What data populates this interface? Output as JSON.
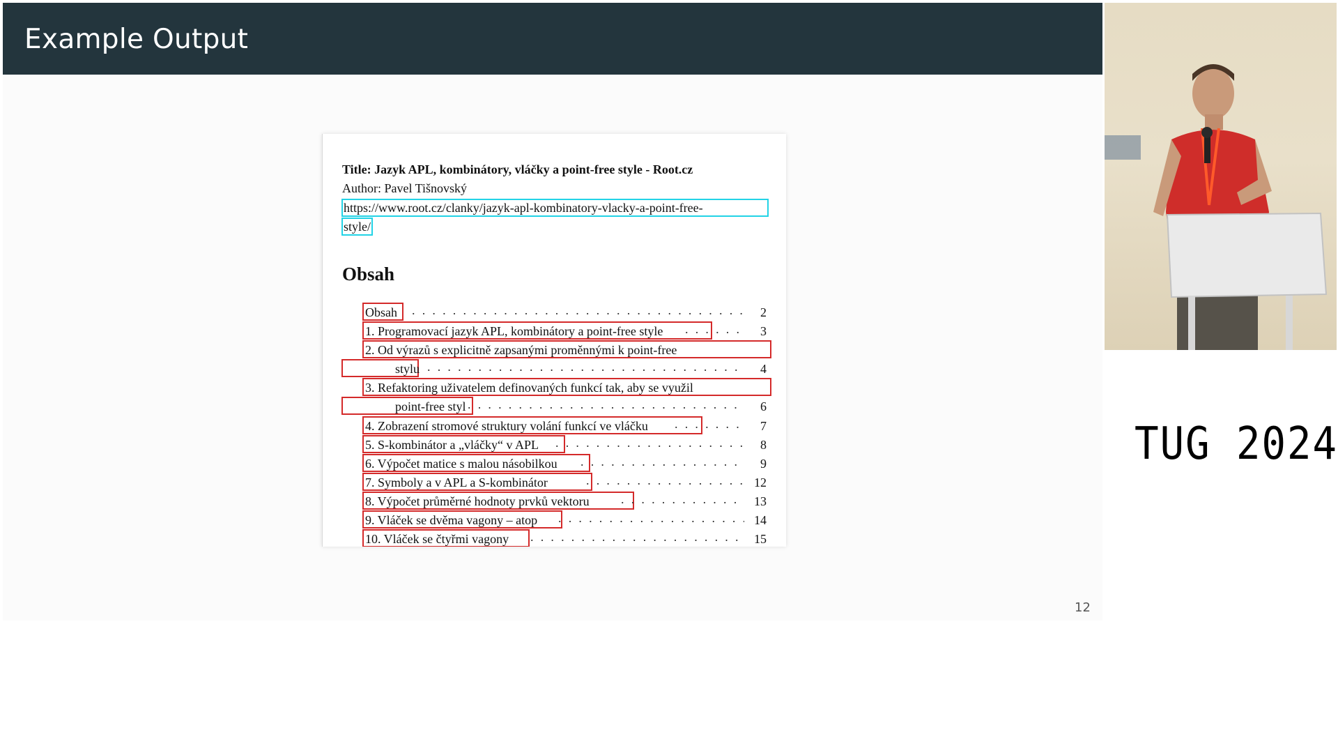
{
  "slide": {
    "title": "Example Output",
    "number": "12"
  },
  "document": {
    "title": "Title: Jazyk APL, kombinátory, vláčky a point-free style - Root.cz",
    "author": "Author: Pavel Tišnovský",
    "url_line1": "https://www.root.cz/clanky/jazyk-apl-kombinatory-vlacky-a-point-free-",
    "url_line2": "style/",
    "toc_heading": "Obsah",
    "toc": [
      {
        "text": "Obsah",
        "page": "2"
      },
      {
        "text": "1. Programovací jazyk APL, kombinátory a point-free style",
        "page": "3"
      },
      {
        "text": "2. Od výrazů s explicitně zapsanými proměnnými k point-free",
        "page": ""
      },
      {
        "text": "stylu",
        "page": "4"
      },
      {
        "text": "3. Refaktoring uživatelem definovaných funkcí tak, aby se využil",
        "page": ""
      },
      {
        "text": "point-free styl",
        "page": "6"
      },
      {
        "text": "4. Zobrazení stromové struktury volání funkcí ve vláčku",
        "page": "7"
      },
      {
        "text": "5. S-kombinátor a „vláčky“ v APL",
        "page": "8"
      },
      {
        "text": "6. Výpočet matice s malou násobilkou",
        "page": "9"
      },
      {
        "text": "7. Symboly    a     v APL a S-kombinátor",
        "page": "12"
      },
      {
        "text": "8. Výpočet průměrné hodnoty prvků vektoru",
        "page": "13"
      },
      {
        "text": "9. Vláček se dvěma vagony – atop",
        "page": "14"
      },
      {
        "text": "10. Vláček se čtyřmi vagony",
        "page": "15"
      }
    ]
  },
  "camera": {
    "description_icon": "speaker-video-feed"
  },
  "event_logo": "TUG 2024",
  "colors": {
    "header_bg": "#23353d",
    "link_box": "#22d3e6",
    "annotation_box": "#d42a2a"
  }
}
